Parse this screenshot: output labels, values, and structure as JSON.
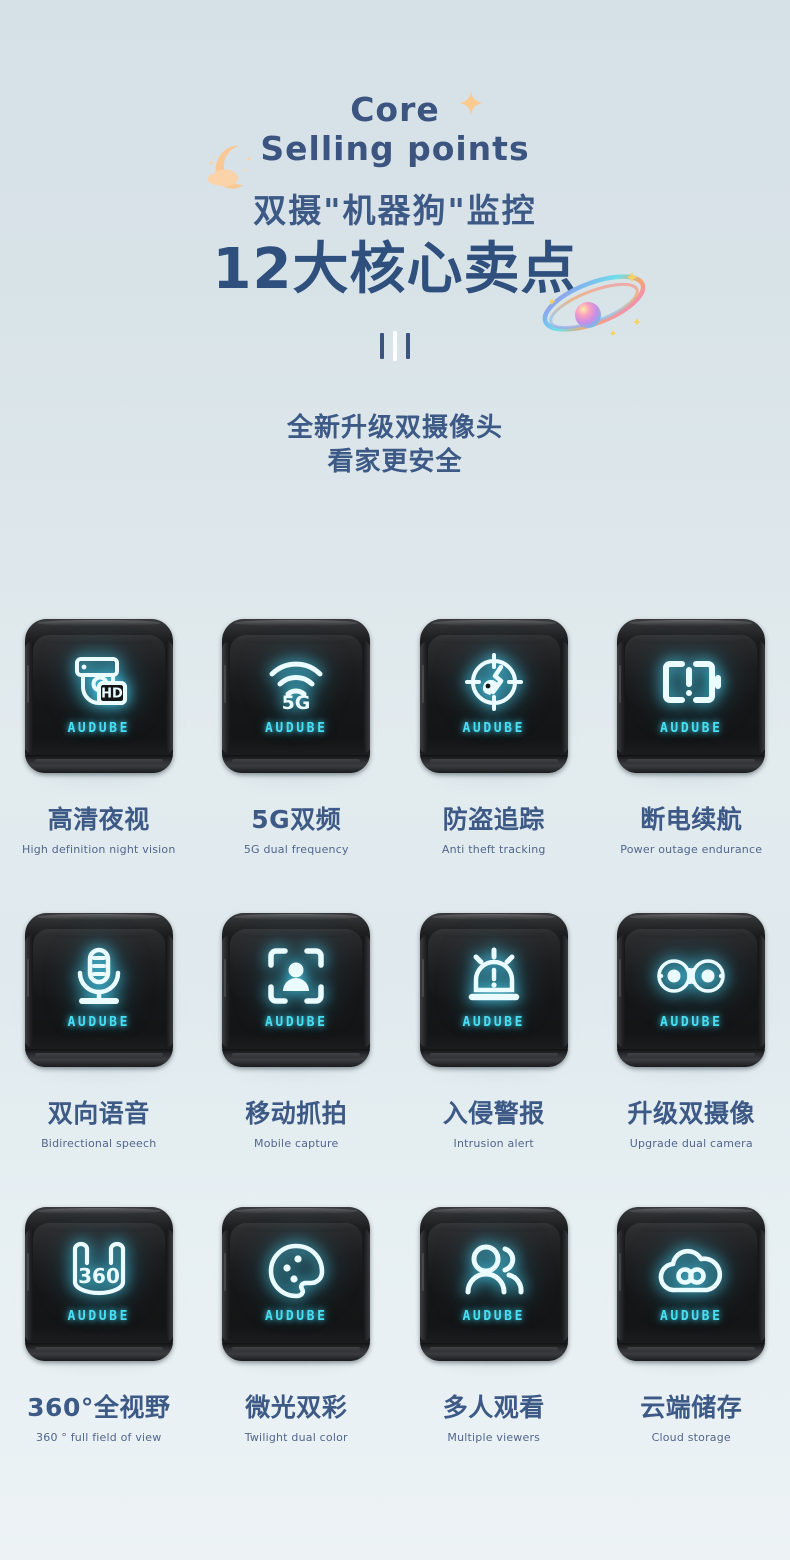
{
  "header": {
    "en_line1": "Core",
    "en_line2": "Selling points",
    "cn_subtitle": "双摄\"机器狗\"监控",
    "cn_headline": "12大核心卖点",
    "tagline_line1": "全新升级双摄像头",
    "tagline_line2": "看家更安全"
  },
  "colors": {
    "background_top": "#d6e1e7",
    "background_bottom": "#edf3f5",
    "heading_blue": "#2f4f7d",
    "subtitle_blue": "#3d5986",
    "neon_cyan": "#49e0f5",
    "device_black": "#161718",
    "deco_peach": "#f9c893",
    "label_en_blue": "#51668c"
  },
  "brand": "AUDUBE",
  "features": [
    {
      "icon": "hd-camera-icon",
      "cn": "高清夜视",
      "en": "High definition night vision",
      "badge": "HD"
    },
    {
      "icon": "wifi-5g-icon",
      "cn": "5G双频",
      "en": "5G dual frequency",
      "badge": "5G"
    },
    {
      "icon": "anti-theft-target-icon",
      "cn": "防盗追踪",
      "en": "Anti theft tracking",
      "badge": ""
    },
    {
      "icon": "battery-alert-icon",
      "cn": "断电续航",
      "en": "Power outage endurance",
      "badge": ""
    },
    {
      "icon": "microphone-icon",
      "cn": "双向语音",
      "en": "Bidirectional speech",
      "badge": ""
    },
    {
      "icon": "person-detect-icon",
      "cn": "移动抓拍",
      "en": "Mobile capture",
      "badge": ""
    },
    {
      "icon": "alarm-siren-icon",
      "cn": "入侵警报",
      "en": "Intrusion alert",
      "badge": ""
    },
    {
      "icon": "dual-lens-icon",
      "cn": "升级双摄像",
      "en": "Upgrade dual camera",
      "badge": ""
    },
    {
      "icon": "panorama-360-icon",
      "cn": "360°全视野",
      "en": "360 ° full field of view",
      "badge": "360"
    },
    {
      "icon": "color-palette-icon",
      "cn": "微光双彩",
      "en": "Twilight dual color",
      "badge": ""
    },
    {
      "icon": "multi-user-icon",
      "cn": "多人观看",
      "en": "Multiple viewers",
      "badge": ""
    },
    {
      "icon": "cloud-infinity-icon",
      "cn": "云端储存",
      "en": "Cloud storage",
      "badge": ""
    }
  ],
  "decorations": {
    "sparkle": "sparkle-icon",
    "moon": "moon-cloud-icon",
    "planet": "planet-ring-icon",
    "divider": "three-bar-divider"
  }
}
